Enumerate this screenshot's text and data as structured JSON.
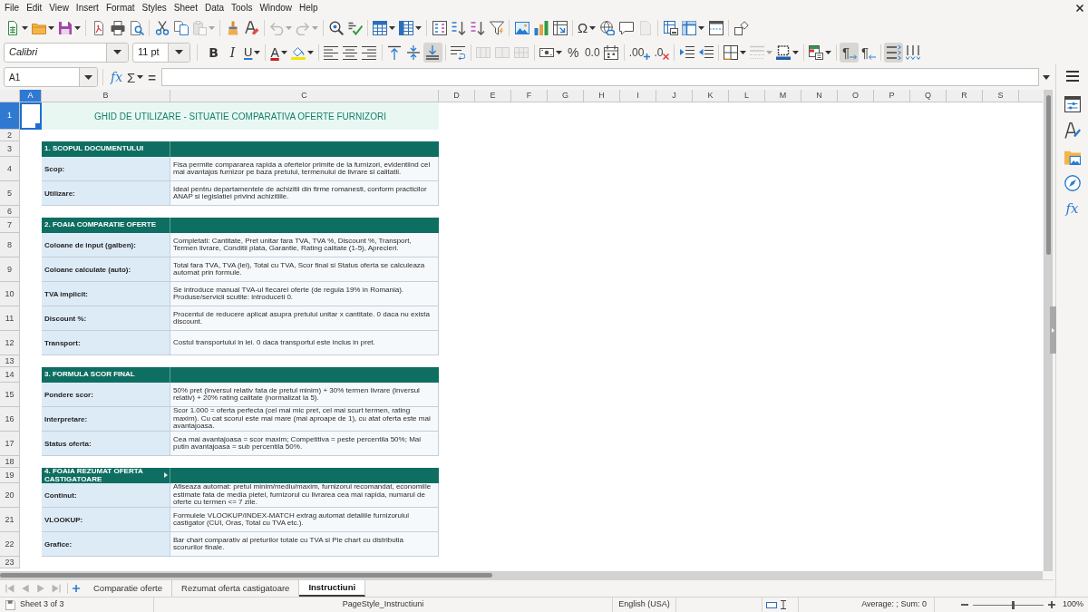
{
  "menu_bar": [
    "File",
    "Edit",
    "View",
    "Insert",
    "Format",
    "Styles",
    "Sheet",
    "Data",
    "Tools",
    "Window",
    "Help"
  ],
  "standard_toolbar": [
    {
      "disabled": false
    },
    {
      "disabled": false
    },
    {
      "disabled": false
    },
    {
      "disabled": false
    },
    {
      "disabled": false
    },
    {
      "disabled": false
    },
    {
      "disabled": false
    },
    {
      "disabled": false
    },
    {
      "disabled": true
    },
    {
      "disabled": false
    },
    {
      "disabled": false
    },
    {
      "disabled": true
    },
    {
      "disabled": true
    },
    {
      "disabled": false
    },
    {
      "disabled": false
    },
    {
      "disabled": false
    },
    {
      "disabled": false
    },
    {
      "disabled": false
    },
    {
      "disabled": false
    },
    {
      "disabled": false
    },
    {
      "disabled": false
    },
    {
      "disabled": false
    },
    {
      "disabled": false
    },
    {
      "disabled": false
    },
    {
      "disabled": false,
      "glyph": "Ω"
    },
    {
      "disabled": false
    },
    {
      "disabled": false
    },
    {
      "disabled": true
    },
    {
      "disabled": false
    },
    {
      "disabled": false
    },
    {
      "disabled": false
    },
    {
      "disabled": false
    }
  ],
  "formatting_toolbar": {
    "font_name": "Calibri",
    "font_size": "11 pt",
    "buttons": [
      {
        "glyph": "B",
        "disabled": false,
        "pressed": false
      },
      {
        "glyph": "I",
        "disabled": false,
        "pressed": false
      },
      {
        "glyph": "U",
        "disabled": false,
        "pressed": false
      },
      {
        "glyph": "A",
        "disabled": false,
        "pressed": false
      },
      {
        "disabled": false,
        "pressed": false
      },
      {
        "disabled": false,
        "pressed": false
      },
      {
        "disabled": false,
        "pressed": false
      },
      {
        "disabled": false,
        "pressed": false
      },
      {
        "disabled": false,
        "pressed": false
      },
      {
        "disabled": false,
        "pressed": false
      },
      {
        "disabled": false,
        "pressed": true
      },
      {
        "disabled": false,
        "pressed": false
      },
      {
        "disabled": true,
        "pressed": false
      },
      {
        "disabled": true,
        "pressed": false
      },
      {
        "disabled": true,
        "pressed": false
      },
      {
        "disabled": false,
        "pressed": false
      },
      {
        "glyph": "%",
        "disabled": false,
        "pressed": false
      },
      {
        "glyph": "0.0",
        "disabled": false,
        "pressed": false
      },
      {
        "disabled": false,
        "pressed": false
      },
      {
        "glyph": ".00",
        "disabled": false,
        "pressed": false
      },
      {
        "glyph": ".0",
        "disabled": false,
        "pressed": false
      },
      {
        "disabled": false,
        "pressed": false
      },
      {
        "disabled": false,
        "pressed": false
      },
      {
        "disabled": false,
        "pressed": false
      },
      {
        "disabled": true,
        "pressed": false
      },
      {
        "disabled": false,
        "pressed": false
      },
      {
        "disabled": false,
        "pressed": false
      },
      {
        "glyph": "¶",
        "disabled": false,
        "pressed": true
      },
      {
        "glyph": "¶",
        "disabled": false,
        "pressed": false
      },
      {
        "disabled": false,
        "pressed": true
      },
      {
        "disabled": false,
        "pressed": false
      }
    ]
  },
  "formula_bar": {
    "name_box": "A1",
    "function_wizard": "fx",
    "sum": "Σ",
    "equals": "="
  },
  "sheet": {
    "columns": [
      {
        "label": "A",
        "selected": true
      },
      {
        "label": "B",
        "selected": false
      },
      {
        "label": "C",
        "selected": false
      },
      {
        "label": "D",
        "selected": false
      },
      {
        "label": "E",
        "selected": false
      },
      {
        "label": "F",
        "selected": false
      },
      {
        "label": "G",
        "selected": false
      },
      {
        "label": "H",
        "selected": false
      },
      {
        "label": "I",
        "selected": false
      },
      {
        "label": "J",
        "selected": false
      },
      {
        "label": "K",
        "selected": false
      },
      {
        "label": "L",
        "selected": false
      },
      {
        "label": "M",
        "selected": false
      },
      {
        "label": "N",
        "selected": false
      },
      {
        "label": "O",
        "selected": false
      },
      {
        "label": "P",
        "selected": false
      },
      {
        "label": "Q",
        "selected": false
      },
      {
        "label": "R",
        "selected": false
      },
      {
        "label": "S",
        "selected": false
      }
    ],
    "rows": [
      {
        "header": "1",
        "selected": true,
        "kind": "title",
        "text": "GHID DE UTILIZARE - SITUATIE COMPARATIVA OFERTE FURNIZORI"
      },
      {
        "header": "2",
        "selected": false,
        "kind": "blank"
      },
      {
        "header": "3",
        "selected": false,
        "kind": "section",
        "text": "1. SCOPUL DOCUMENTULUI",
        "clipped": false
      },
      {
        "header": "4",
        "selected": false,
        "kind": "entry",
        "label": "Scop:",
        "description": "Fisa permite compararea rapida a ofertelor primite de la furnizori, evidentiind cel mai avantajos furnizor pe baza pretului, termenului de livrare si calitatii."
      },
      {
        "header": "5",
        "selected": false,
        "kind": "entry",
        "label": "Utilizare:",
        "description": "Ideal pentru departamentele de achizitii din firme romanesti, conform practicilor ANAP si legislatiei privind achizitiile."
      },
      {
        "header": "6",
        "selected": false,
        "kind": "blank"
      },
      {
        "header": "7",
        "selected": false,
        "kind": "section",
        "text": "2. FOAIA COMPARATIE OFERTE",
        "clipped": false
      },
      {
        "header": "8",
        "selected": false,
        "kind": "entry",
        "label": "Coloane de input (galben):",
        "description": "Completati: Cantitate, Pret unitar fara TVA, TVA %, Discount %, Transport, Termen livrare, Conditii plata, Garantie, Rating calitate (1-5), Aprecieri."
      },
      {
        "header": "9",
        "selected": false,
        "kind": "entry",
        "label": "Coloane calculate (auto):",
        "description": "Total fara TVA, TVA (lei), Total cu TVA, Scor final si Status oferta se calculeaza automat prin formule."
      },
      {
        "header": "10",
        "selected": false,
        "kind": "entry",
        "label": "TVA implicit:",
        "description": "Se introduce manual TVA-ul fiecarei oferte (de regula 19% in Romania). Produse/servicii scutite: introduceti 0."
      },
      {
        "header": "11",
        "selected": false,
        "kind": "entry",
        "label": "Discount %:",
        "description": "Procentul de reducere aplicat asupra pretului unitar x cantitate. 0 daca nu exista discount."
      },
      {
        "header": "12",
        "selected": false,
        "kind": "entry",
        "label": "Transport:",
        "description": "Costul transportului in lei. 0 daca transportul este inclus in pret."
      },
      {
        "header": "13",
        "selected": false,
        "kind": "blank"
      },
      {
        "header": "14",
        "selected": false,
        "kind": "section",
        "text": "3. FORMULA SCOR FINAL",
        "clipped": false
      },
      {
        "header": "15",
        "selected": false,
        "kind": "entry",
        "label": "Pondere scor:",
        "description": "50% pret (inversul relativ fata de pretul minim) + 30% termen livrare (inversul relativ) + 20% rating calitate (normalizat la 5)."
      },
      {
        "header": "16",
        "selected": false,
        "kind": "entry",
        "label": "Interpretare:",
        "description": "Scor 1.000 = oferta perfecta (cel mai mic pret, cel mai scurt termen, rating maxim). Cu cat scorul este mai mare (mai aproape de 1), cu atat oferta este mai avantajoasa."
      },
      {
        "header": "17",
        "selected": false,
        "kind": "entry",
        "label": "Status oferta:",
        "description": "Cea mai avantajoasa = scor maxim; Competitiva = peste percentila 50%; Mai putin avantajoasa = sub percentila 50%."
      },
      {
        "header": "18",
        "selected": false,
        "kind": "blank"
      },
      {
        "header": "19",
        "selected": false,
        "kind": "section",
        "text": "4. FOAIA REZUMAT OFERTA CASTIGATOARE",
        "clipped": true
      },
      {
        "header": "20",
        "selected": false,
        "kind": "entry",
        "label": "Continut:",
        "description": "Afiseaza automat: pretul minim/mediu/maxim, furnizorul recomandat, economiile estimate fata de media pietei, furnizorul cu livrarea cea mai rapida, numarul de oferte cu termen <= 7 zile."
      },
      {
        "header": "21",
        "selected": false,
        "kind": "entry",
        "label": "VLOOKUP:",
        "description": "Formulele VLOOKUP/INDEX-MATCH extrag automat detaliile furnizorului castigator (CUI, Oras, Total cu TVA etc.)."
      },
      {
        "header": "22",
        "selected": false,
        "kind": "entry",
        "label": "Grafice:",
        "description": "Bar chart comparativ al preturilor totale cu TVA si Pie chart cu distributia scorurilor finale."
      },
      {
        "header": "23",
        "selected": false,
        "kind": "blank"
      }
    ]
  },
  "sheet_tabs": {
    "navigation": [
      {
        "disabled": true
      },
      {
        "disabled": true
      },
      {
        "disabled": true
      },
      {
        "disabled": true
      }
    ],
    "tabs": [
      {
        "label": "Comparatie oferte",
        "selected": false
      },
      {
        "label": "Rezumat oferta castigatoare",
        "selected": false
      },
      {
        "label": "Instructiuni",
        "selected": true
      }
    ]
  },
  "sidebar": {
    "functions": "fx"
  },
  "status_bar": {
    "sheet_position": "Sheet 3 of 3",
    "page_style": "PageStyle_Instructiuni",
    "language": "English (USA)",
    "selection_summary": "Average: ; Sum: 0",
    "zoom": {
      "level": 0.57,
      "reading": "100%"
    }
  }
}
